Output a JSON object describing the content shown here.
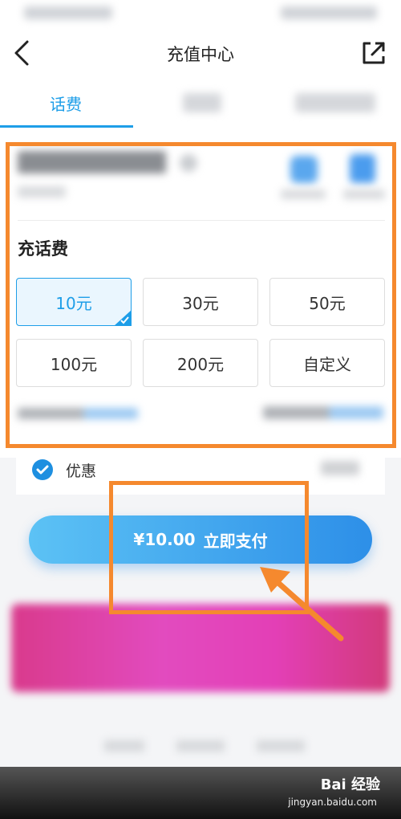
{
  "nav": {
    "title": "充值中心"
  },
  "tabs": [
    {
      "label": "话费"
    }
  ],
  "recharge": {
    "section_title": "充话费",
    "amounts": [
      "10元",
      "30元",
      "50元",
      "100元",
      "200元",
      "自定义"
    ],
    "selected_index": 0
  },
  "discount": {
    "label": "优惠",
    "checked": true
  },
  "pay": {
    "price": "¥10.00",
    "label": "立即支付"
  },
  "watermark": {
    "brand": "Bai 经验",
    "url": "jingyan.baidu.com"
  },
  "colors": {
    "accent": "#1e9ee8",
    "annotation": "#f5892e",
    "banner": "#e24bbf"
  }
}
